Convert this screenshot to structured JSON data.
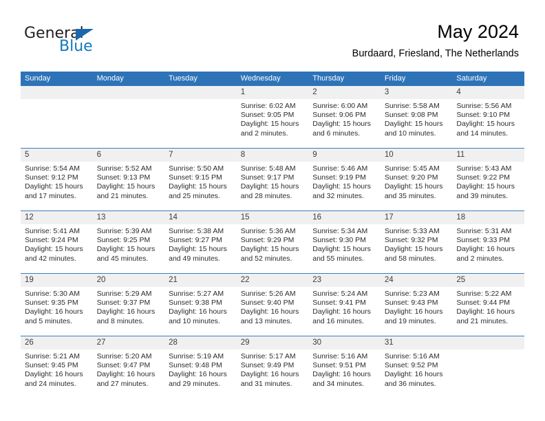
{
  "logo": {
    "word1": "General",
    "word2": "Blue",
    "triangle_color": "#1b68ad",
    "blue_text_color": "#1278be"
  },
  "header": {
    "title": "May 2024",
    "location": "Burdaard, Friesland, The Netherlands",
    "header_bg": "#2e73b8",
    "daynum_bg": "#f0f0f0"
  },
  "weekday_headers": [
    "Sunday",
    "Monday",
    "Tuesday",
    "Wednesday",
    "Thursday",
    "Friday",
    "Saturday"
  ],
  "weeks": [
    [
      {
        "day": "",
        "empty": true,
        "sunrise": "",
        "sunset": "",
        "daylight1": "",
        "daylight2": ""
      },
      {
        "day": "",
        "empty": true,
        "sunrise": "",
        "sunset": "",
        "daylight1": "",
        "daylight2": ""
      },
      {
        "day": "",
        "empty": true,
        "sunrise": "",
        "sunset": "",
        "daylight1": "",
        "daylight2": ""
      },
      {
        "day": "1",
        "sunrise": "Sunrise: 6:02 AM",
        "sunset": "Sunset: 9:05 PM",
        "daylight1": "Daylight: 15 hours",
        "daylight2": "and 2 minutes."
      },
      {
        "day": "2",
        "sunrise": "Sunrise: 6:00 AM",
        "sunset": "Sunset: 9:06 PM",
        "daylight1": "Daylight: 15 hours",
        "daylight2": "and 6 minutes."
      },
      {
        "day": "3",
        "sunrise": "Sunrise: 5:58 AM",
        "sunset": "Sunset: 9:08 PM",
        "daylight1": "Daylight: 15 hours",
        "daylight2": "and 10 minutes."
      },
      {
        "day": "4",
        "sunrise": "Sunrise: 5:56 AM",
        "sunset": "Sunset: 9:10 PM",
        "daylight1": "Daylight: 15 hours",
        "daylight2": "and 14 minutes."
      }
    ],
    [
      {
        "day": "5",
        "sunrise": "Sunrise: 5:54 AM",
        "sunset": "Sunset: 9:12 PM",
        "daylight1": "Daylight: 15 hours",
        "daylight2": "and 17 minutes."
      },
      {
        "day": "6",
        "sunrise": "Sunrise: 5:52 AM",
        "sunset": "Sunset: 9:13 PM",
        "daylight1": "Daylight: 15 hours",
        "daylight2": "and 21 minutes."
      },
      {
        "day": "7",
        "sunrise": "Sunrise: 5:50 AM",
        "sunset": "Sunset: 9:15 PM",
        "daylight1": "Daylight: 15 hours",
        "daylight2": "and 25 minutes."
      },
      {
        "day": "8",
        "sunrise": "Sunrise: 5:48 AM",
        "sunset": "Sunset: 9:17 PM",
        "daylight1": "Daylight: 15 hours",
        "daylight2": "and 28 minutes."
      },
      {
        "day": "9",
        "sunrise": "Sunrise: 5:46 AM",
        "sunset": "Sunset: 9:19 PM",
        "daylight1": "Daylight: 15 hours",
        "daylight2": "and 32 minutes."
      },
      {
        "day": "10",
        "sunrise": "Sunrise: 5:45 AM",
        "sunset": "Sunset: 9:20 PM",
        "daylight1": "Daylight: 15 hours",
        "daylight2": "and 35 minutes."
      },
      {
        "day": "11",
        "sunrise": "Sunrise: 5:43 AM",
        "sunset": "Sunset: 9:22 PM",
        "daylight1": "Daylight: 15 hours",
        "daylight2": "and 39 minutes."
      }
    ],
    [
      {
        "day": "12",
        "sunrise": "Sunrise: 5:41 AM",
        "sunset": "Sunset: 9:24 PM",
        "daylight1": "Daylight: 15 hours",
        "daylight2": "and 42 minutes."
      },
      {
        "day": "13",
        "sunrise": "Sunrise: 5:39 AM",
        "sunset": "Sunset: 9:25 PM",
        "daylight1": "Daylight: 15 hours",
        "daylight2": "and 45 minutes."
      },
      {
        "day": "14",
        "sunrise": "Sunrise: 5:38 AM",
        "sunset": "Sunset: 9:27 PM",
        "daylight1": "Daylight: 15 hours",
        "daylight2": "and 49 minutes."
      },
      {
        "day": "15",
        "sunrise": "Sunrise: 5:36 AM",
        "sunset": "Sunset: 9:29 PM",
        "daylight1": "Daylight: 15 hours",
        "daylight2": "and 52 minutes."
      },
      {
        "day": "16",
        "sunrise": "Sunrise: 5:34 AM",
        "sunset": "Sunset: 9:30 PM",
        "daylight1": "Daylight: 15 hours",
        "daylight2": "and 55 minutes."
      },
      {
        "day": "17",
        "sunrise": "Sunrise: 5:33 AM",
        "sunset": "Sunset: 9:32 PM",
        "daylight1": "Daylight: 15 hours",
        "daylight2": "and 58 minutes."
      },
      {
        "day": "18",
        "sunrise": "Sunrise: 5:31 AM",
        "sunset": "Sunset: 9:33 PM",
        "daylight1": "Daylight: 16 hours",
        "daylight2": "and 2 minutes."
      }
    ],
    [
      {
        "day": "19",
        "sunrise": "Sunrise: 5:30 AM",
        "sunset": "Sunset: 9:35 PM",
        "daylight1": "Daylight: 16 hours",
        "daylight2": "and 5 minutes."
      },
      {
        "day": "20",
        "sunrise": "Sunrise: 5:29 AM",
        "sunset": "Sunset: 9:37 PM",
        "daylight1": "Daylight: 16 hours",
        "daylight2": "and 8 minutes."
      },
      {
        "day": "21",
        "sunrise": "Sunrise: 5:27 AM",
        "sunset": "Sunset: 9:38 PM",
        "daylight1": "Daylight: 16 hours",
        "daylight2": "and 10 minutes."
      },
      {
        "day": "22",
        "sunrise": "Sunrise: 5:26 AM",
        "sunset": "Sunset: 9:40 PM",
        "daylight1": "Daylight: 16 hours",
        "daylight2": "and 13 minutes."
      },
      {
        "day": "23",
        "sunrise": "Sunrise: 5:24 AM",
        "sunset": "Sunset: 9:41 PM",
        "daylight1": "Daylight: 16 hours",
        "daylight2": "and 16 minutes."
      },
      {
        "day": "24",
        "sunrise": "Sunrise: 5:23 AM",
        "sunset": "Sunset: 9:43 PM",
        "daylight1": "Daylight: 16 hours",
        "daylight2": "and 19 minutes."
      },
      {
        "day": "25",
        "sunrise": "Sunrise: 5:22 AM",
        "sunset": "Sunset: 9:44 PM",
        "daylight1": "Daylight: 16 hours",
        "daylight2": "and 21 minutes."
      }
    ],
    [
      {
        "day": "26",
        "sunrise": "Sunrise: 5:21 AM",
        "sunset": "Sunset: 9:45 PM",
        "daylight1": "Daylight: 16 hours",
        "daylight2": "and 24 minutes."
      },
      {
        "day": "27",
        "sunrise": "Sunrise: 5:20 AM",
        "sunset": "Sunset: 9:47 PM",
        "daylight1": "Daylight: 16 hours",
        "daylight2": "and 27 minutes."
      },
      {
        "day": "28",
        "sunrise": "Sunrise: 5:19 AM",
        "sunset": "Sunset: 9:48 PM",
        "daylight1": "Daylight: 16 hours",
        "daylight2": "and 29 minutes."
      },
      {
        "day": "29",
        "sunrise": "Sunrise: 5:17 AM",
        "sunset": "Sunset: 9:49 PM",
        "daylight1": "Daylight: 16 hours",
        "daylight2": "and 31 minutes."
      },
      {
        "day": "30",
        "sunrise": "Sunrise: 5:16 AM",
        "sunset": "Sunset: 9:51 PM",
        "daylight1": "Daylight: 16 hours",
        "daylight2": "and 34 minutes."
      },
      {
        "day": "31",
        "sunrise": "Sunrise: 5:16 AM",
        "sunset": "Sunset: 9:52 PM",
        "daylight1": "Daylight: 16 hours",
        "daylight2": "and 36 minutes."
      },
      {
        "day": "",
        "empty": true,
        "sunrise": "",
        "sunset": "",
        "daylight1": "",
        "daylight2": ""
      }
    ]
  ]
}
